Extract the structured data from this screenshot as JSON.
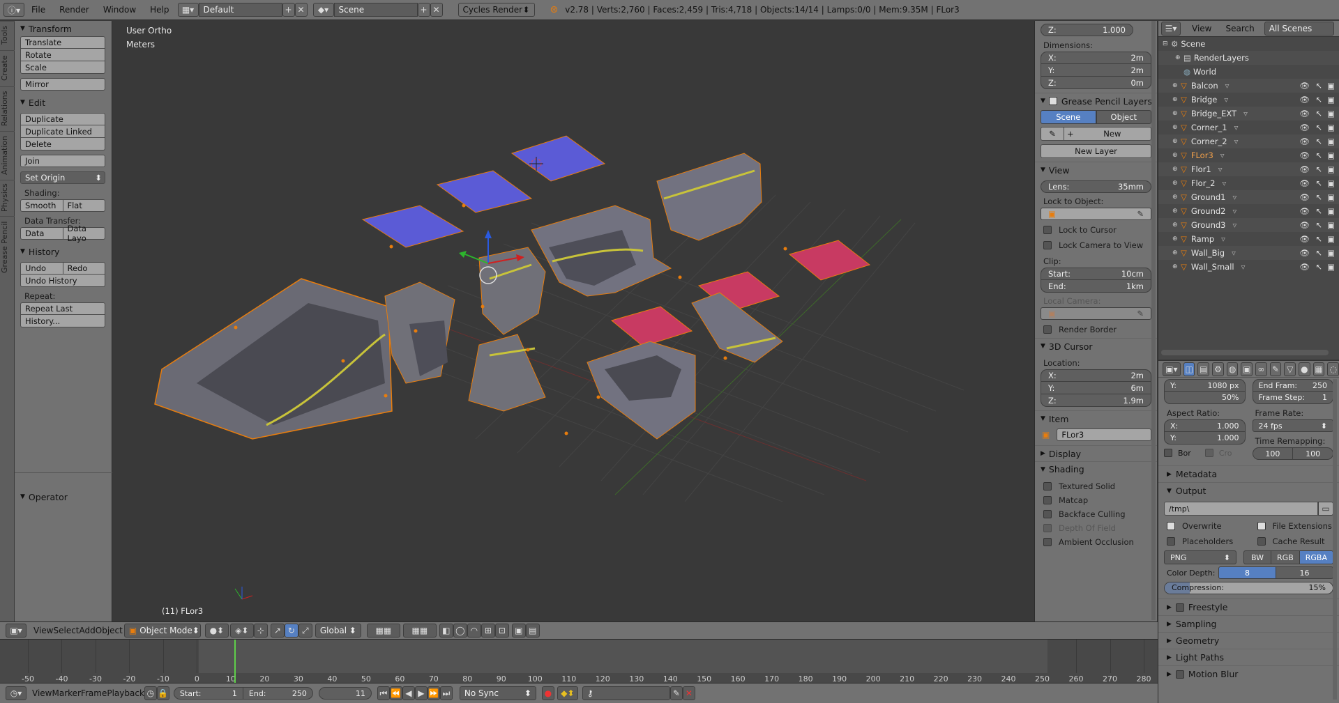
{
  "topbar": {
    "menus": [
      "File",
      "Render",
      "Window",
      "Help"
    ],
    "layout": "Default",
    "scene": "Scene",
    "engine": "Cycles Render",
    "stats": "v2.78 | Verts:2,760 | Faces:2,459 | Tris:4,718 | Objects:14/14 | Lamps:0/0 | Mem:9.35M | FLor3"
  },
  "vtabs": [
    "Tools",
    "Create",
    "Relations",
    "Animation",
    "Physics",
    "Grease Pencil"
  ],
  "tools": {
    "transform": {
      "title": "Transform",
      "buttons": [
        "Translate",
        "Rotate",
        "Scale"
      ],
      "mirror": "Mirror"
    },
    "edit": {
      "title": "Edit",
      "buttons": [
        "Duplicate",
        "Duplicate Linked",
        "Delete"
      ],
      "join": "Join",
      "origin": "Set Origin",
      "shading_label": "Shading:",
      "smooth": "Smooth",
      "flat": "Flat",
      "transfer_label": "Data Transfer:",
      "data": "Data",
      "data_layo": "Data Layo"
    },
    "history": {
      "title": "History",
      "undo": "Undo",
      "redo": "Redo",
      "undo_history": "Undo History",
      "repeat_label": "Repeat:",
      "repeat_last": "Repeat Last",
      "history_btn": "History..."
    },
    "operator": "Operator"
  },
  "viewport": {
    "view_name": "User Ortho",
    "units": "Meters",
    "object_info": "(11) FLor3"
  },
  "npanel": {
    "z_top": {
      "label": "Z:",
      "value": "1.000"
    },
    "dimensions": {
      "label": "Dimensions:",
      "x": "2m",
      "y": "2m",
      "z": "0m"
    },
    "grease": {
      "title": "Grease Pencil Layers",
      "scene": "Scene",
      "object": "Object",
      "new": "New",
      "new_layer": "New Layer"
    },
    "view": {
      "title": "View",
      "lens_label": "Lens:",
      "lens": "35mm",
      "lock_label": "Lock to Object:",
      "lock_cursor": "Lock to Cursor",
      "lock_camera": "Lock Camera to View",
      "clip_label": "Clip:",
      "start_label": "Start:",
      "start": "10cm",
      "end_label": "End:",
      "end": "1km",
      "local_camera": "Local Camera:",
      "render_border": "Render Border"
    },
    "cursor": {
      "title": "3D Cursor",
      "location": "Location:",
      "x": "2m",
      "y": "6m",
      "z": "1.9m"
    },
    "item": {
      "title": "Item",
      "name": "FLor3"
    },
    "display": "Display",
    "shading": {
      "title": "Shading",
      "opts": [
        "Textured Solid",
        "Matcap",
        "Backface Culling",
        "Depth Of Field",
        "Ambient Occlusion"
      ]
    }
  },
  "outliner": {
    "menus": [
      "View",
      "Search"
    ],
    "filter": "All Scenes",
    "scene": "Scene",
    "render_layers": "RenderLayers",
    "world": "World",
    "objects": [
      "Balcon",
      "Bridge",
      "Bridge_EXT",
      "Corner_1",
      "Corner_2",
      "FLor3",
      "Flor1",
      "Flor_2",
      "Ground1",
      "Ground2",
      "Ground3",
      "Ramp",
      "Wall_Big",
      "Wall_Small"
    ]
  },
  "properties": {
    "res_y": {
      "label": "Y:",
      "value": "1080 px"
    },
    "pct": "50%",
    "end_frame": {
      "label": "End Fram:",
      "value": "250"
    },
    "frame_step": {
      "label": "Frame Step:",
      "value": "1"
    },
    "aspect_label": "Aspect Ratio:",
    "aspect_x": {
      "label": "X:",
      "value": "1.000"
    },
    "aspect_y": {
      "label": "Y:",
      "value": "1.000"
    },
    "frame_rate_label": "Frame Rate:",
    "fps": "24 fps",
    "time_remap": "Time Remapping:",
    "remap_a": "100",
    "remap_b": "100",
    "bor": "Bor",
    "cro": "Cro",
    "metadata": "Metadata",
    "output": "Output",
    "path": "/tmp\\",
    "overwrite": "Overwrite",
    "file_ext": "File Extensions",
    "placeholders": "Placeholders",
    "cache": "Cache Result",
    "format": "PNG",
    "bw": "BW",
    "rgb": "RGB",
    "rgba": "RGBA",
    "depth_label": "Color Depth:",
    "depth8": "8",
    "depth16": "16",
    "compression_label": "Compression:",
    "compression": "15%",
    "compression_value": 0.15,
    "sections": [
      "Freestyle",
      "Sampling",
      "Geometry",
      "Light Paths",
      "Motion Blur"
    ]
  },
  "vheader": {
    "menus": [
      "View",
      "Select",
      "Add",
      "Object"
    ],
    "mode": "Object Mode",
    "orientation": "Global"
  },
  "timeline": {
    "ticks": [
      "-50",
      "-40",
      "-30",
      "-20",
      "-10",
      "0",
      "10",
      "20",
      "30",
      "40",
      "50",
      "60",
      "70",
      "80",
      "90",
      "100",
      "110",
      "120",
      "130",
      "140",
      "150",
      "160",
      "170",
      "180",
      "190",
      "200",
      "210",
      "220",
      "230",
      "240",
      "250",
      "260",
      "270",
      "280"
    ],
    "current_frame": 11,
    "menus": [
      "View",
      "Marker",
      "Frame",
      "Playback"
    ],
    "start_label": "Start:",
    "start": "1",
    "end_label": "End:",
    "end": "250",
    "current": "11",
    "sync": "No Sync"
  }
}
